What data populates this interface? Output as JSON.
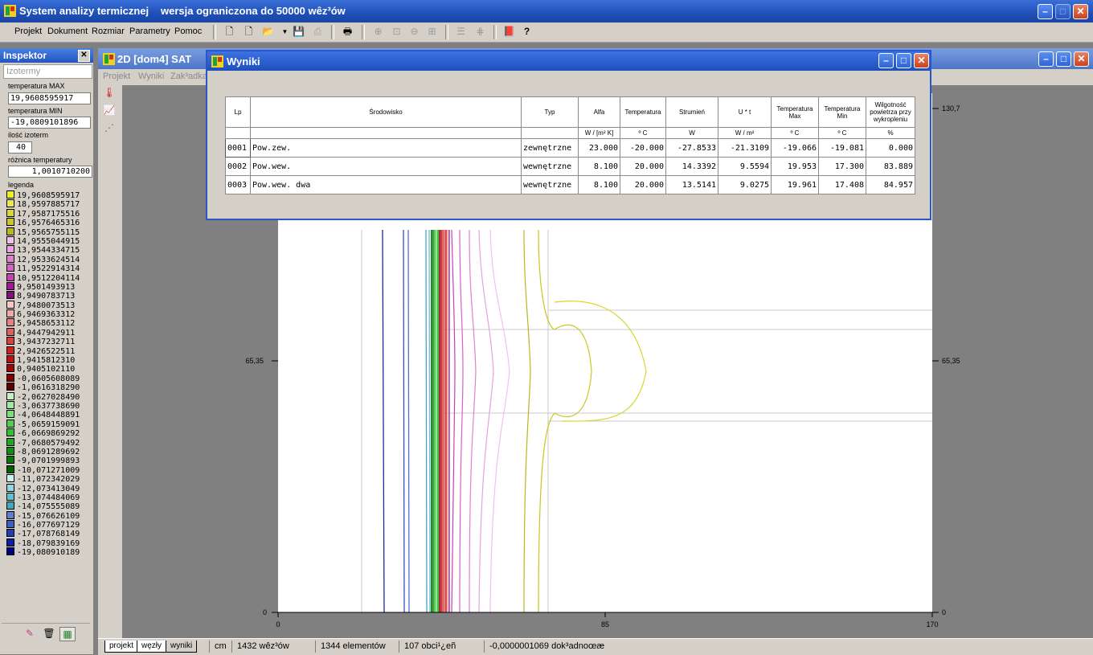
{
  "app": {
    "title": "System analizy termicznej",
    "subtitle": "wersja ograniczona do 50000 wêz³ów"
  },
  "menu": [
    {
      "label": "Projekt",
      "key": "P"
    },
    {
      "label": "Dokument",
      "key": "D"
    },
    {
      "label": "Rozmiar",
      "key": "R"
    },
    {
      "label": "Parametry",
      "key": ""
    },
    {
      "label": "Pomoc",
      "key": "P"
    }
  ],
  "inspector": {
    "title": "Inspektor",
    "tab": "Izotermy",
    "temp_max_label": "temperatura MAX",
    "temp_max": "19,9608595917",
    "temp_min_label": "temperatura MIN",
    "temp_min": "-19,0809101896",
    "count_label": "ilość izoterm",
    "count": "40",
    "diff_label": "różnica temperatury",
    "diff": "1,0010710200",
    "legend_label": "legenda",
    "legend": [
      {
        "value": "19,9608595917",
        "color": "#f0f020"
      },
      {
        "value": "18,9597885717",
        "color": "#e8e850"
      },
      {
        "value": "17,9587175516",
        "color": "#d8d830"
      },
      {
        "value": "16,9576465316",
        "color": "#c8c820"
      },
      {
        "value": "15,9565755115",
        "color": "#b8b818"
      },
      {
        "value": "14,9555044915",
        "color": "#f0c0f0"
      },
      {
        "value": "13,9544334715",
        "color": "#e8a0e0"
      },
      {
        "value": "12,9533624514",
        "color": "#e080d0"
      },
      {
        "value": "11,9522914314",
        "color": "#d860c8"
      },
      {
        "value": "10,9512204114",
        "color": "#c840b8"
      },
      {
        "value": "9,9501493913",
        "color": "#a01898"
      },
      {
        "value": "8,9490783713",
        "color": "#801080"
      },
      {
        "value": "7,9480073513",
        "color": "#f8c8c8"
      },
      {
        "value": "6,9469363312",
        "color": "#f0a8a8"
      },
      {
        "value": "5,9458653112",
        "color": "#e88080"
      },
      {
        "value": "4,9447942911",
        "color": "#e06060"
      },
      {
        "value": "3,9437232711",
        "color": "#d84040"
      },
      {
        "value": "2,9426522511",
        "color": "#d02020"
      },
      {
        "value": "1,9415812310",
        "color": "#c01010"
      },
      {
        "value": "0,9405102110",
        "color": "#a00808"
      },
      {
        "value": "-0,0605608089",
        "color": "#800000"
      },
      {
        "value": "-1,0616318290",
        "color": "#600000"
      },
      {
        "value": "-2,0627028490",
        "color": "#c8f0c8"
      },
      {
        "value": "-3,0637738690",
        "color": "#a0e8a0"
      },
      {
        "value": "-4,0648448891",
        "color": "#78e078"
      },
      {
        "value": "-5,0659159091",
        "color": "#50d050"
      },
      {
        "value": "-6,0669869292",
        "color": "#30c030"
      },
      {
        "value": "-7,0680579492",
        "color": "#20a820"
      },
      {
        "value": "-8,0691289692",
        "color": "#109010"
      },
      {
        "value": "-9,0701999893",
        "color": "#087808"
      },
      {
        "value": "-10,071271009",
        "color": "#006000"
      },
      {
        "value": "-11,072342029",
        "color": "#c8f0f0"
      },
      {
        "value": "-12,073413049",
        "color": "#90d8e0"
      },
      {
        "value": "-13,074484069",
        "color": "#60c0d0"
      },
      {
        "value": "-14,075555089",
        "color": "#40a8c0"
      },
      {
        "value": "-15,076626109",
        "color": "#6080d0"
      },
      {
        "value": "-16,077697129",
        "color": "#4060c0"
      },
      {
        "value": "-17,078768149",
        "color": "#2040b0"
      },
      {
        "value": "-18,079839169",
        "color": "#1020a0"
      },
      {
        "value": "-19,080910189",
        "color": "#000080"
      }
    ]
  },
  "child": {
    "title": "2D    [dom4]  SAT",
    "menu": [
      "Projekt",
      "Wyniki",
      "Zak³adka"
    ]
  },
  "plot": {
    "left_top": "130,7",
    "left_mid": "65,35",
    "right_top": "130,7",
    "right_mid": "65,35",
    "y_zero": "0",
    "right_zero": "0",
    "x0": "0",
    "x_mid": "85",
    "x_max": "170"
  },
  "status": {
    "tabs": [
      "projekt",
      "węzły",
      "wyniki"
    ],
    "unit": "cm",
    "nodes": "1432 wêz³ów",
    "elements": "1344 elementów",
    "loads": "107 obci¹¿eñ",
    "precision": "-0,0000001069 dok³adnoœæ"
  },
  "wyniki": {
    "title": "Wyniki",
    "headers": {
      "lp": "Lp",
      "env": "Środowisko",
      "typ": "Typ",
      "alfa": "Alfa",
      "temp": "Temperatura",
      "flux": "Strumień",
      "ut": "U * t",
      "tmax": "Temperatura Max",
      "tmin": "Temperatura Min",
      "humid": "Wilgotność powietrza przy wykropleniu"
    },
    "units": {
      "alfa": "W / [m² K]",
      "temp": "º C",
      "flux": "W",
      "ut": "W / m²",
      "tmax": "º C",
      "tmin": "º C",
      "humid": "%"
    },
    "rows": [
      {
        "lp": "0001",
        "env": "Pow.zew.",
        "typ": "zewnętrzne",
        "alfa": "23.000",
        "temp": "-20.000",
        "flux": "-27.8533",
        "ut": "-21.3109",
        "tmax": "-19.066",
        "tmin": "-19.081",
        "humid": "0.000"
      },
      {
        "lp": "0002",
        "env": "Pow.wew.",
        "typ": "wewnętrzne",
        "alfa": "8.100",
        "temp": "20.000",
        "flux": "14.3392",
        "ut": "9.5594",
        "tmax": "19.953",
        "tmin": "17.300",
        "humid": "83.889"
      },
      {
        "lp": "0003",
        "env": "Pow.wew. dwa",
        "typ": "wewnętrzne",
        "alfa": "8.100",
        "temp": "20.000",
        "flux": "13.5141",
        "ut": "9.0275",
        "tmax": "19.961",
        "tmin": "17.408",
        "humid": "84.957"
      }
    ]
  }
}
